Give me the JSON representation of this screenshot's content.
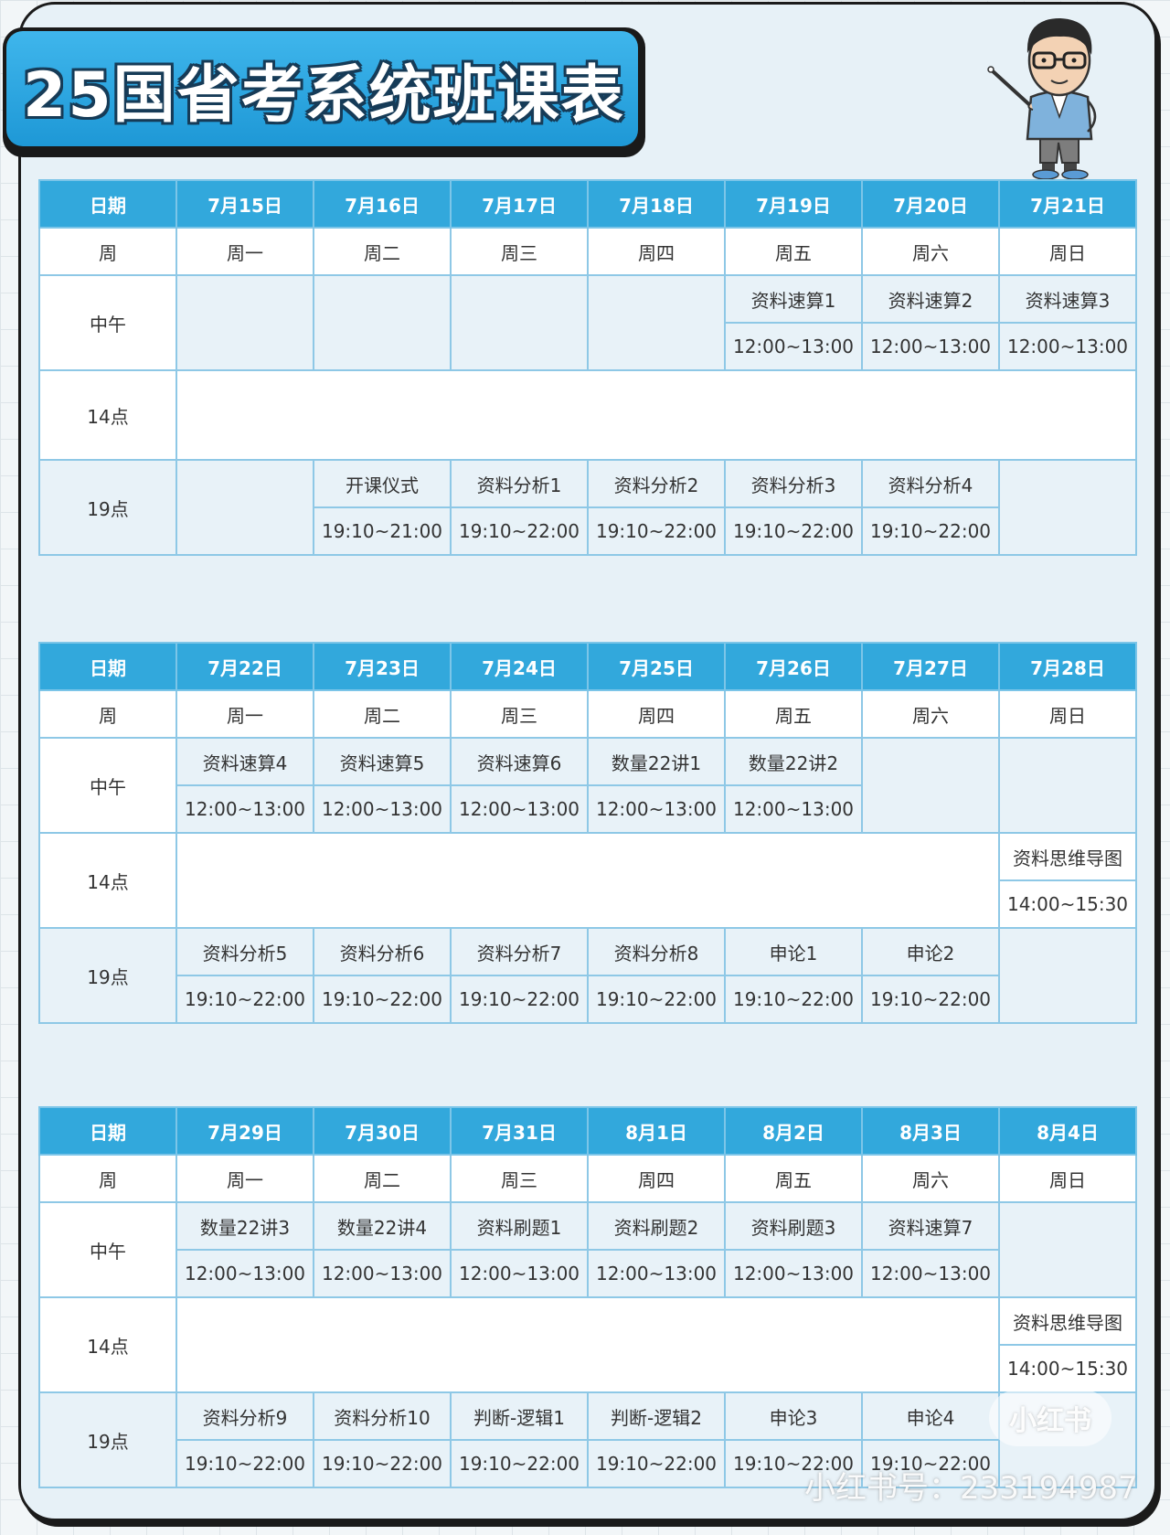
{
  "title": "25国省考系统班课表",
  "headers": {
    "date": "日期",
    "week": "周",
    "noon": "中午",
    "p14": "14点",
    "p19": "19点"
  },
  "weekdays": [
    "周一",
    "周二",
    "周三",
    "周四",
    "周五",
    "周六",
    "周日"
  ],
  "weeks": [
    {
      "dates": [
        "7月15日",
        "7月16日",
        "7月17日",
        "7月18日",
        "7月19日",
        "7月20日",
        "7月21日"
      ],
      "noon": [
        null,
        null,
        null,
        null,
        {
          "course": "资料速算1",
          "time": "12:00~13:00"
        },
        {
          "course": "资料速算2",
          "time": "12:00~13:00"
        },
        {
          "course": "资料速算3",
          "time": "12:00~13:00"
        }
      ],
      "p14": [
        null,
        null,
        null,
        null,
        null,
        null,
        null
      ],
      "p19": [
        null,
        {
          "course": "开课仪式",
          "time": "19:10~21:00"
        },
        {
          "course": "资料分析1",
          "time": "19:10~22:00"
        },
        {
          "course": "资料分析2",
          "time": "19:10~22:00"
        },
        {
          "course": "资料分析3",
          "time": "19:10~22:00"
        },
        {
          "course": "资料分析4",
          "time": "19:10~22:00"
        },
        null
      ]
    },
    {
      "dates": [
        "7月22日",
        "7月23日",
        "7月24日",
        "7月25日",
        "7月26日",
        "7月27日",
        "7月28日"
      ],
      "noon": [
        {
          "course": "资料速算4",
          "time": "12:00~13:00"
        },
        {
          "course": "资料速算5",
          "time": "12:00~13:00"
        },
        {
          "course": "资料速算6",
          "time": "12:00~13:00"
        },
        {
          "course": "数量22讲1",
          "time": "12:00~13:00"
        },
        {
          "course": "数量22讲2",
          "time": "12:00~13:00"
        },
        null,
        null
      ],
      "p14": [
        null,
        null,
        null,
        null,
        null,
        null,
        {
          "course": "资料思维导图",
          "time": "14:00~15:30"
        }
      ],
      "p19": [
        {
          "course": "资料分析5",
          "time": "19:10~22:00"
        },
        {
          "course": "资料分析6",
          "time": "19:10~22:00"
        },
        {
          "course": "资料分析7",
          "time": "19:10~22:00"
        },
        {
          "course": "资料分析8",
          "time": "19:10~22:00"
        },
        {
          "course": "申论1",
          "time": "19:10~22:00"
        },
        {
          "course": "申论2",
          "time": "19:10~22:00"
        },
        null
      ]
    },
    {
      "dates": [
        "7月29日",
        "7月30日",
        "7月31日",
        "8月1日",
        "8月2日",
        "8月3日",
        "8月4日"
      ],
      "noon": [
        {
          "course": "数量22讲3",
          "time": "12:00~13:00"
        },
        {
          "course": "数量22讲4",
          "time": "12:00~13:00"
        },
        {
          "course": "资料刷题1",
          "time": "12:00~13:00"
        },
        {
          "course": "资料刷题2",
          "time": "12:00~13:00"
        },
        {
          "course": "资料刷题3",
          "time": "12:00~13:00"
        },
        {
          "course": "资料速算7",
          "time": "12:00~13:00"
        },
        null
      ],
      "p14": [
        null,
        null,
        null,
        null,
        null,
        null,
        {
          "course": "资料思维导图",
          "time": "14:00~15:30"
        }
      ],
      "p19": [
        {
          "course": "资料分析9",
          "time": "19:10~22:00"
        },
        {
          "course": "资料分析10",
          "time": "19:10~22:00"
        },
        {
          "course": "判断-逻辑1",
          "time": "19:10~22:00"
        },
        {
          "course": "判断-逻辑2",
          "time": "19:10~22:00"
        },
        {
          "course": "申论3",
          "time": "19:10~22:00"
        },
        {
          "course": "申论4",
          "time": "19:10~22:00"
        },
        null
      ]
    }
  ],
  "watermark": {
    "logo": "小红书",
    "id": "小红书号：233194987"
  }
}
